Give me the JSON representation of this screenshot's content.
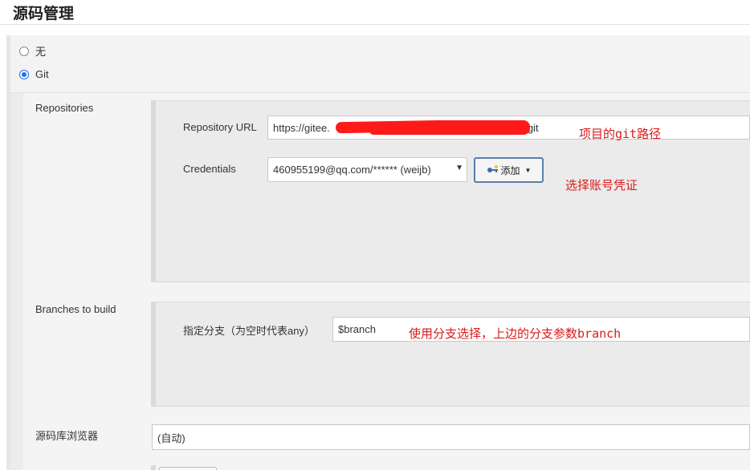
{
  "section": {
    "title": "源码管理"
  },
  "scm_options": [
    {
      "label": "无",
      "checked": false
    },
    {
      "label": "Git",
      "checked": true
    }
  ],
  "repositories": {
    "label": "Repositories",
    "url_label": "Repository URL",
    "url_value_prefix": "https://gitee.",
    "url_value_suffix": "git",
    "credentials_label": "Credentials",
    "credentials_value": "460955199@qq.com/****** (weijb)",
    "add_button_label": "添加"
  },
  "branches": {
    "label": "Branches to build",
    "branch_label": "指定分支（为空时代表any）",
    "branch_value": "$branch"
  },
  "browser": {
    "label": "源码库浏览器",
    "value": "(自动)"
  },
  "annotations": {
    "repo_url_note": "项目的git路径",
    "credentials_note": "选择账号凭证",
    "branch_note": "使用分支选择，上边的分支参数branch"
  },
  "colors": {
    "annotation": "#d91a1a",
    "radio_accent": "#1a73e8",
    "redaction": "#ff1a1a"
  }
}
